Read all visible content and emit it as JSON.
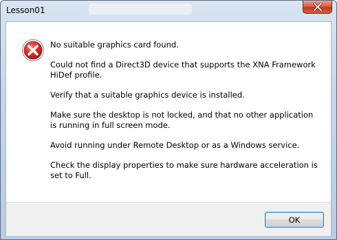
{
  "window": {
    "title": "Lesson01",
    "close_icon": "close-icon"
  },
  "dialog": {
    "icon": "error-icon",
    "icon_color": "#c8232c",
    "messages": [
      "No suitable graphics card found.",
      "Could not find a Direct3D device that supports the XNA Framework HiDef profile.",
      "Verify that a suitable graphics device is installed.",
      "Make sure the desktop is not locked, and that no other application is running in full screen mode.",
      "Avoid running under Remote Desktop or as a Windows service.",
      "Check the display properties to make sure hardware acceleration is set to Full."
    ],
    "ok_label": "OK"
  }
}
